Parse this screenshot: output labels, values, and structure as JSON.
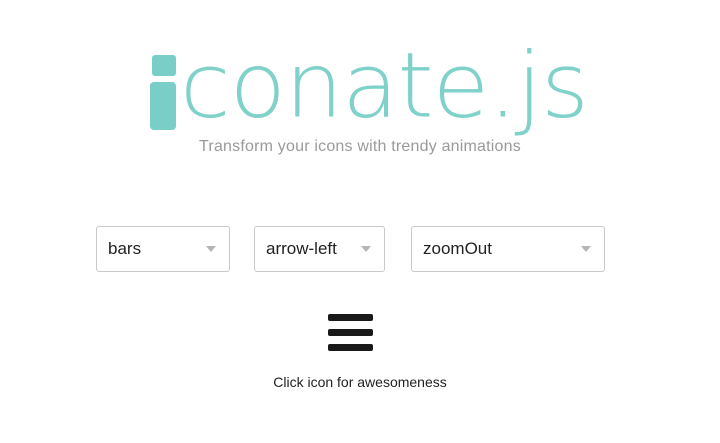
{
  "logo": {
    "text": "conate.js",
    "alt": "iconate.js",
    "color": "#79cfc7"
  },
  "tagline": "Transform your icons with trendy animations",
  "selects": {
    "icon": {
      "value": "bars"
    },
    "animation_in": {
      "value": "arrow-left"
    },
    "animation_out": {
      "value": "zoomOut"
    }
  },
  "preview_icon": "bars-icon",
  "hint": "Click icon for awesomeness"
}
